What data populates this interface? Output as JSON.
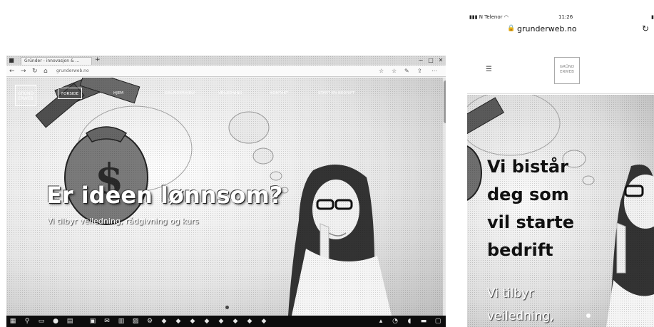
{
  "desktop": {
    "browser": {
      "tab_title": "Gründer - innovasjon & ...",
      "new_tab_symbol": "+",
      "window_controls": [
        "−",
        "□",
        "✕"
      ],
      "url": "grunderweb.no",
      "nav_icons": [
        "arrow-left-icon",
        "arrow-right-icon",
        "reload-icon",
        "home-icon"
      ],
      "toolbar_icons": [
        "star-icon",
        "favorites-icon",
        "pen-icon",
        "share-icon",
        "more-icon"
      ]
    },
    "site": {
      "logo_text": "GRÜND ERWEB",
      "nav": [
        "Forside",
        "Hjem",
        "Gründerhjelp",
        "Veiledning",
        "Kontakt",
        "Start en bedrift"
      ],
      "active_nav_index": 0,
      "hero_title": "Er ideen lønnsom?",
      "hero_subtitle": "Vi tilbyr veiledning, rådgivning og kurs"
    },
    "taskbar_icons": [
      "windows-icon",
      "search-icon",
      "task-view-icon",
      "edge-icon",
      "file-explorer-icon",
      "store-icon",
      "mail-icon",
      "calendar-icon",
      "photos-icon",
      "settings-icon"
    ]
  },
  "mobile": {
    "carrier": "N Telenor",
    "time": "11:26",
    "battery_symbol": "▮",
    "url": "grunderweb.no",
    "logo_text": "GRÜND ERWEB",
    "hero_title": "Vi bistår deg som vil starte bedrift",
    "hero_subtitle": "Vi tilbyr veiledning,"
  }
}
